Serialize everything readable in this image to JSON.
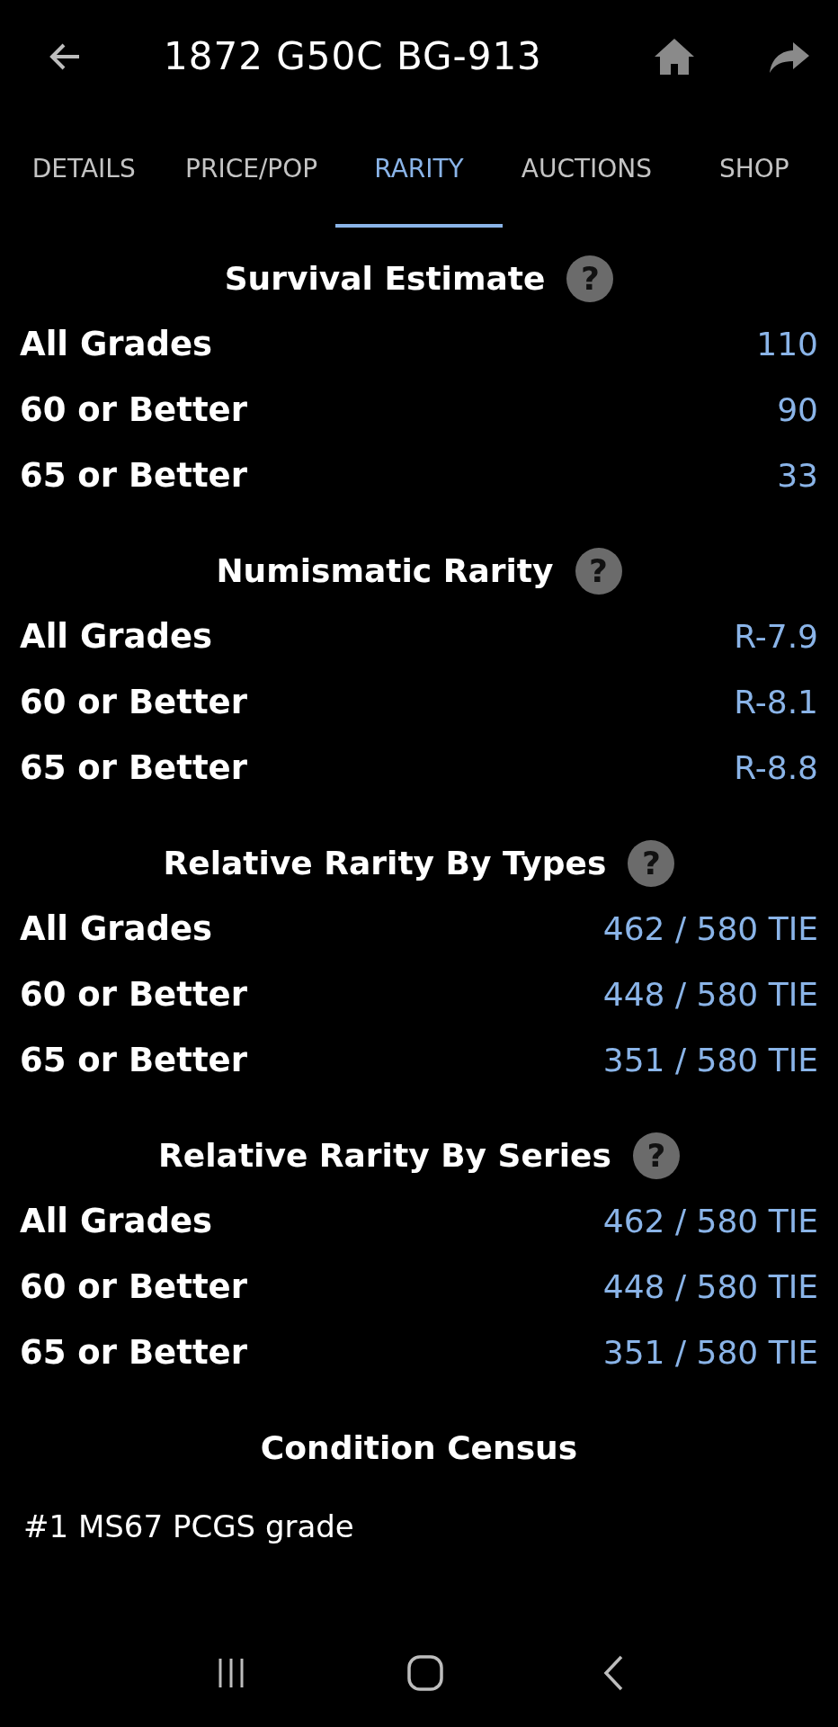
{
  "header": {
    "title": "1872 G50C BG-913"
  },
  "tabs": [
    {
      "label": "DETAILS",
      "selected": false
    },
    {
      "label": "PRICE/POP",
      "selected": false
    },
    {
      "label": "RARITY",
      "selected": true
    },
    {
      "label": "AUCTIONS",
      "selected": false
    },
    {
      "label": "SHOP",
      "selected": false
    }
  ],
  "sections": [
    {
      "heading": "Survival Estimate",
      "help": "?",
      "rows": [
        {
          "label": "All Grades",
          "value": "110"
        },
        {
          "label": "60 or Better",
          "value": "90"
        },
        {
          "label": "65 or Better",
          "value": "33"
        }
      ]
    },
    {
      "heading": "Numismatic Rarity",
      "help": "?",
      "rows": [
        {
          "label": "All Grades",
          "value": "R-7.9"
        },
        {
          "label": "60 or Better",
          "value": "R-8.1"
        },
        {
          "label": "65 or Better",
          "value": "R-8.8"
        }
      ]
    },
    {
      "heading": "Relative Rarity By Types",
      "help": "?",
      "rows": [
        {
          "label": "All Grades",
          "value": "462 / 580 TIE"
        },
        {
          "label": "60 or Better",
          "value": "448 / 580 TIE"
        },
        {
          "label": "65 or Better",
          "value": "351 / 580 TIE"
        }
      ]
    },
    {
      "heading": "Relative Rarity By Series",
      "help": "?",
      "rows": [
        {
          "label": "All Grades",
          "value": "462 / 580 TIE"
        },
        {
          "label": "60 or Better",
          "value": "448 / 580 TIE"
        },
        {
          "label": "65 or Better",
          "value": "351 / 580 TIE"
        }
      ]
    }
  ],
  "census": {
    "heading": "Condition Census",
    "entries": [
      "#1 MS67 PCGS grade"
    ]
  }
}
